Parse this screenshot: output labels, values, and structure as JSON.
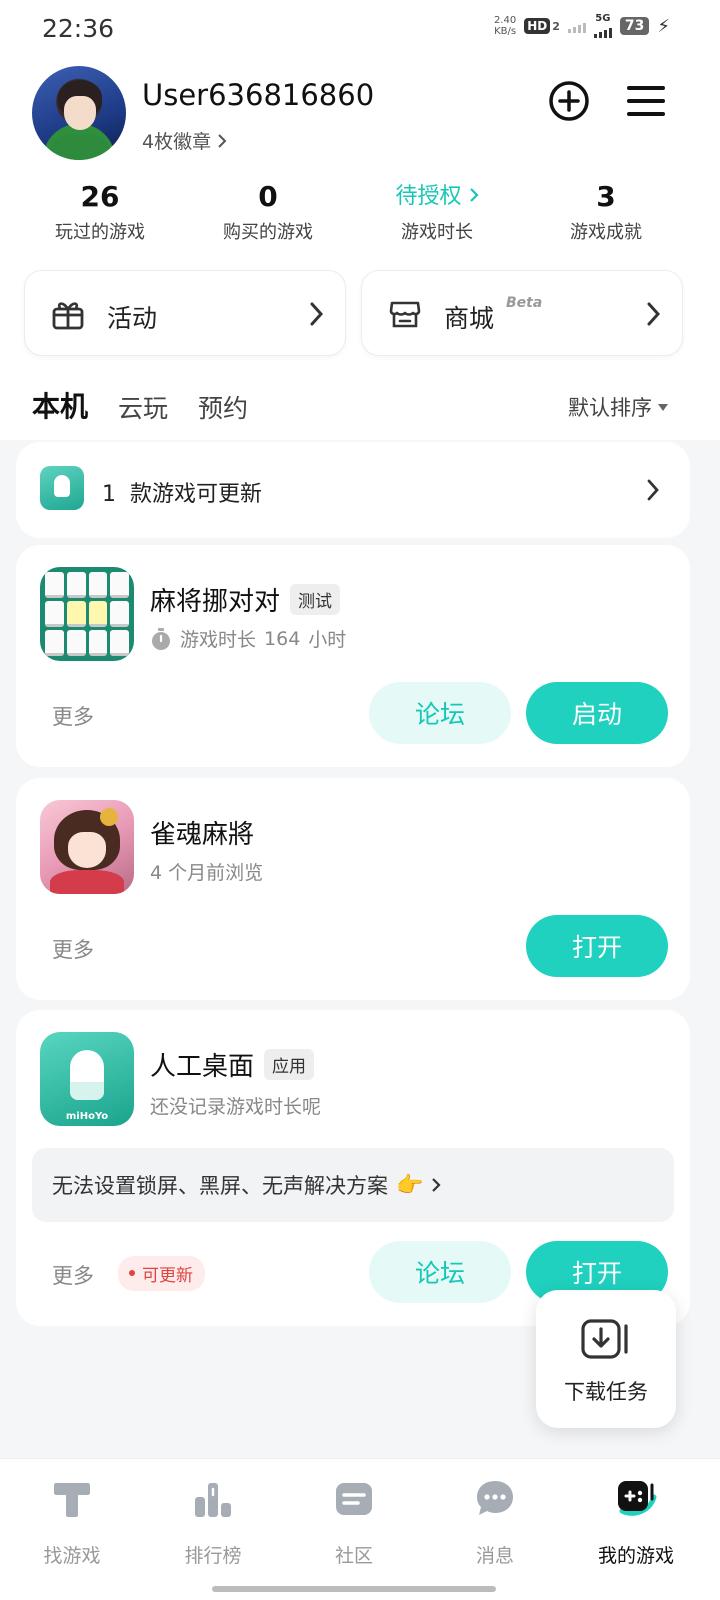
{
  "status_bar": {
    "time": "22:36",
    "net_speed_value": "2.40",
    "net_speed_unit": "KB/s",
    "hd_label": "HD",
    "hd_sub": "2",
    "network": "5G",
    "battery": "73"
  },
  "profile": {
    "username": "User636816860",
    "badges": "4枚徽章"
  },
  "stats": [
    {
      "value": "26",
      "label": "玩过的游戏"
    },
    {
      "value": "0",
      "label": "购买的游戏"
    },
    {
      "value": "待授权",
      "label": "游戏时长"
    },
    {
      "value": "3",
      "label": "游戏成就"
    }
  ],
  "quick_entries": {
    "activity": "活动",
    "store": "商城",
    "store_badge": "Beta"
  },
  "tabs": [
    "本机",
    "云玩",
    "预约"
  ],
  "sort_label": "默认排序",
  "update_banner": {
    "count": "1",
    "text": "款游戏可更新"
  },
  "games": [
    {
      "title": "麻将挪对对",
      "tag": "测试",
      "sub_prefix": "游戏时长",
      "sub_value": "164",
      "sub_unit": "小时",
      "more": "更多",
      "forum": "论坛",
      "action": "启动"
    },
    {
      "title": "雀魂麻將",
      "sub": "4 个月前浏览",
      "more": "更多",
      "action": "打开"
    },
    {
      "title": "人工桌面",
      "tag": "应用",
      "sub": "还没记录游戏时长呢",
      "notice": "无法设置锁屏、黑屏、无声解决方案",
      "more": "更多",
      "update_badge": "可更新",
      "forum": "论坛",
      "action": "打开",
      "brand": "miHoYo"
    }
  ],
  "download_tasks": "下载任务",
  "bottom_nav": [
    {
      "label": "找游戏"
    },
    {
      "label": "排行榜"
    },
    {
      "label": "社区"
    },
    {
      "label": "消息"
    },
    {
      "label": "我的游戏",
      "active": true
    }
  ],
  "colors": {
    "accent": "#1fd1be",
    "accent_light": "#e5faf7",
    "badge_red": "#e0443f"
  }
}
